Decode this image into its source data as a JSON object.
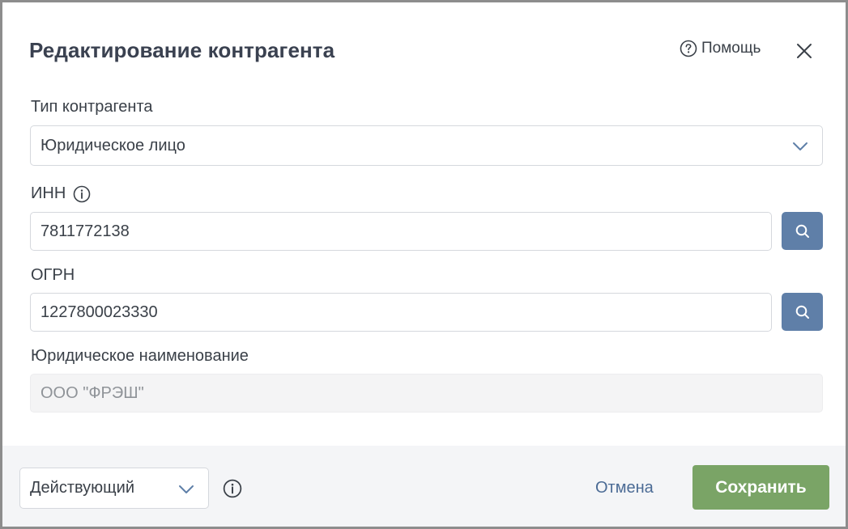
{
  "dialog": {
    "title": "Редактирование контрагента",
    "help_label": "Помощь"
  },
  "fields": {
    "type": {
      "label": "Тип контрагента",
      "value": "Юридическое лицо"
    },
    "inn": {
      "label": "ИНН",
      "value": "7811772138"
    },
    "ogrn": {
      "label": "ОГРН",
      "value": "1227800023330"
    },
    "legal_name": {
      "label": "Юридическое наименование",
      "value": "ООО \"ФРЭШ\""
    }
  },
  "footer": {
    "status_value": "Действующий",
    "cancel_label": "Отмена",
    "save_label": "Сохранить"
  },
  "colors": {
    "accent_blue": "#5f7fa8",
    "save_green": "#7aa466",
    "link_blue": "#4b6b95"
  },
  "icons": [
    "help-circle-icon",
    "close-icon",
    "chevron-down-icon",
    "info-icon",
    "search-icon"
  ]
}
